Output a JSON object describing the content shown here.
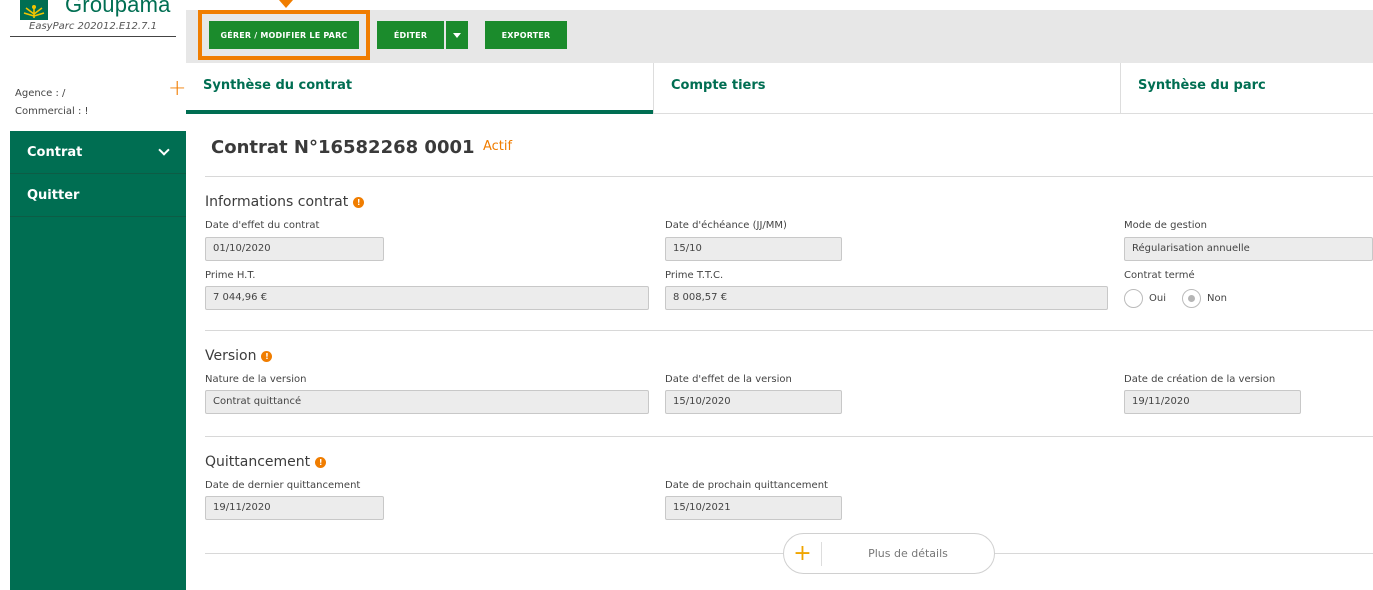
{
  "brand": {
    "name": "Groupama",
    "version": "EasyParc 202012.E12.7.1"
  },
  "agent": {
    "agence_label": "Agence : /",
    "commercial_label": "Commercial : !",
    "add_symbol": "+"
  },
  "sidebar": {
    "items": [
      {
        "label": "Contrat",
        "icon": "chevron-down-icon"
      },
      {
        "label": "Quitter"
      }
    ]
  },
  "toolbar": {
    "gerer_label": "GÉRER / MODIFIER LE PARC",
    "editer_label": "ÉDITER",
    "exporter_label": "EXPORTER",
    "highlight_color": "#f07d00",
    "button_color": "#1b8b2c"
  },
  "tabs": [
    {
      "label": "Synthèse du contrat",
      "active": true
    },
    {
      "label": "Compte tiers"
    },
    {
      "label": "Synthèse du parc"
    }
  ],
  "contract": {
    "title": "Contrat N°16582268 0001",
    "status": "Actif"
  },
  "sections": {
    "info": {
      "title": "Informations contrat",
      "date_effet_label": "Date d'effet du contrat",
      "date_effet": "01/10/2020",
      "date_echeance_label": "Date d'échéance (JJ/MM)",
      "date_echeance": "15/10",
      "mode_gestion_label": "Mode de gestion",
      "mode_gestion": "Régularisation annuelle",
      "prime_ht_label": "Prime H.T.",
      "prime_ht": "7 044,96 €",
      "prime_ttc_label": "Prime T.T.C.",
      "prime_ttc": "8 008,57 €",
      "contrat_terme_label": "Contrat termé",
      "oui_label": "Oui",
      "non_label": "Non",
      "selected": "Non"
    },
    "version": {
      "title": "Version",
      "nature_label": "Nature de la version",
      "nature": "Contrat quittancé",
      "date_effet_label": "Date d'effet de la version",
      "date_effet": "15/10/2020",
      "date_creation_label": "Date de création de la version",
      "date_creation": "19/11/2020"
    },
    "quittancement": {
      "title": "Quittancement",
      "dernier_label": "Date de dernier quittancement",
      "dernier": "19/11/2020",
      "prochain_label": "Date de prochain quittancement",
      "prochain": "15/10/2021"
    }
  },
  "more": {
    "symbol": "+",
    "label": "Plus de détails"
  },
  "colors": {
    "primary_green": "#006e52",
    "accent_orange": "#f07d00"
  }
}
